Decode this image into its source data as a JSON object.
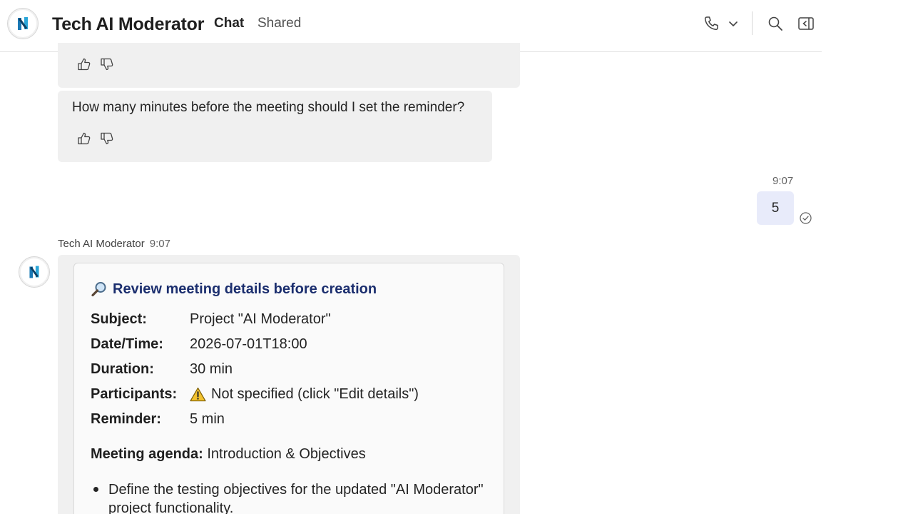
{
  "header": {
    "title": "Tech AI Moderator",
    "tabs": [
      {
        "label": "Chat",
        "active": true
      },
      {
        "label": "Shared",
        "active": false
      }
    ],
    "icons": [
      "call-icon",
      "chevron-down-icon",
      "search-icon",
      "open-panel-icon"
    ],
    "accent_color": "#5b5fc7"
  },
  "messages": {
    "question": "How many minutes before the meeting should I set the reminder?",
    "user_reply": {
      "time": "9:07",
      "text": "5"
    },
    "bot_reply": {
      "sender": "Tech AI Moderator",
      "time": "9:07"
    }
  },
  "card": {
    "title": "Review meeting details before creation",
    "rows": [
      {
        "label": "Subject:",
        "value": "Project \"AI Moderator\""
      },
      {
        "label": "Date/Time:",
        "value": "2026-07-01T18:00"
      },
      {
        "label": "Duration:",
        "value": "30 min"
      },
      {
        "label": "Participants:",
        "value": "Not specified (click \"Edit details\")"
      },
      {
        "label": "Reminder:",
        "value": "5 min"
      }
    ],
    "agenda_label": "Meeting agenda:",
    "agenda_value": "Introduction & Objectives",
    "bullets": [
      "Define the testing objectives for the updated \"AI Moderator\" project functionality."
    ]
  }
}
